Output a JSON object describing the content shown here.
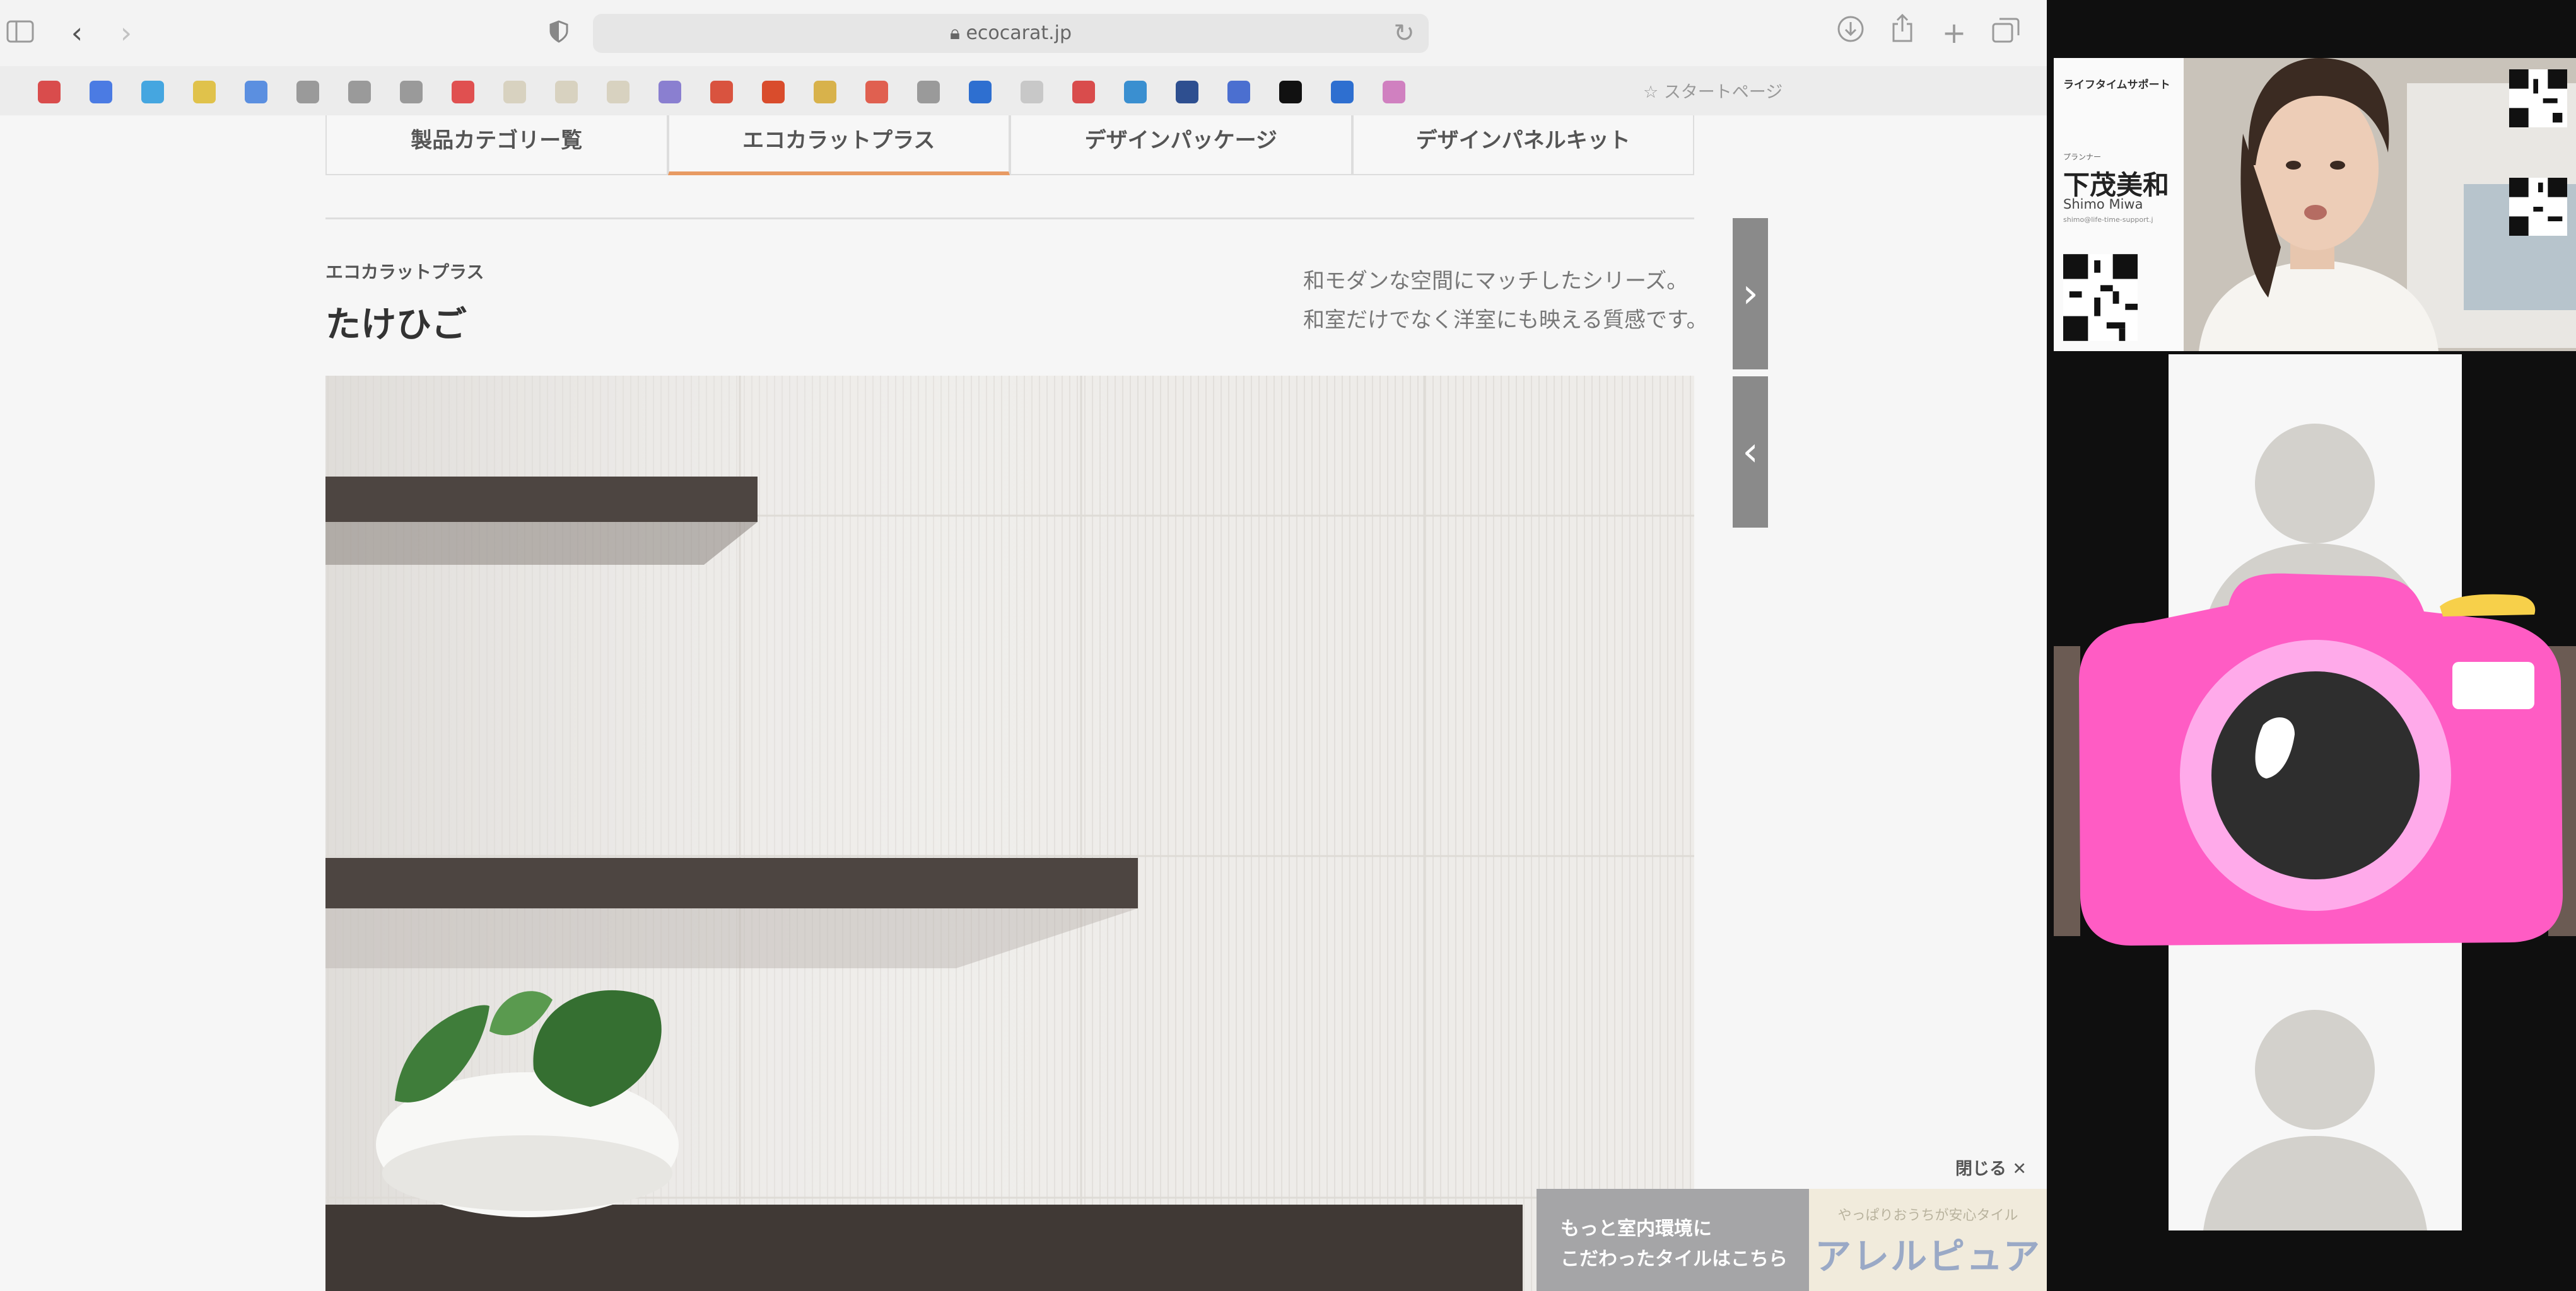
{
  "browser": {
    "url": "ecocarat.jp",
    "start_page_label": "スタートページ",
    "favorites": [
      {
        "color": "#d94c4c"
      },
      {
        "color": "#4b7be3"
      },
      {
        "color": "#45a6e0"
      },
      {
        "color": "#e0c24b"
      },
      {
        "color": "#5b8fe0"
      },
      {
        "color": "#9a9a9a"
      },
      {
        "color": "#9a9a9a"
      },
      {
        "color": "#9a9a9a"
      },
      {
        "color": "#e05050"
      },
      {
        "color": "#d8d2c0"
      },
      {
        "color": "#d8d2c0"
      },
      {
        "color": "#d8d2c0"
      },
      {
        "color": "#8a7fd0"
      },
      {
        "color": "#d9533f"
      },
      {
        "color": "#d94c2c"
      },
      {
        "color": "#d8b24b"
      },
      {
        "color": "#e06050"
      },
      {
        "color": "#9a9a9a"
      },
      {
        "color": "#2e6fd0"
      },
      {
        "color": "#c8c8c8"
      },
      {
        "color": "#d94c4c"
      },
      {
        "color": "#3a8fd0"
      },
      {
        "color": "#2e4f90"
      },
      {
        "color": "#4b6fd0"
      },
      {
        "color": "#111111"
      },
      {
        "color": "#2e6fd0"
      },
      {
        "color": "#d080c0"
      }
    ]
  },
  "page": {
    "tabs": [
      {
        "label": "製品カテゴリー覧",
        "active": false
      },
      {
        "label": "エコカラットプラス",
        "active": true
      },
      {
        "label": "デザインパッケージ",
        "active": false
      },
      {
        "label": "デザインパネルキット",
        "active": false
      }
    ],
    "subtitle": "エコカラットプラス",
    "title": "たけひご",
    "description_line1": "和モダンな空間にマッチしたシリーズ。",
    "description_line2": "和室だけでなく洋室にも映える質感です。",
    "next_glyph": "›",
    "prev_glyph": "‹"
  },
  "banner": {
    "close_label": "閉じる",
    "close_glyph": "✕",
    "line1": "もっと室内環境に",
    "line2": "こだわったタイルはこちら",
    "tagline": "やっぱりおうちが安心タイル",
    "brand": "アレルピュア"
  },
  "video": {
    "card_label": "ライフタイムサポート",
    "card_role": "プランナー",
    "card_name": "下茂美和",
    "card_romaji": "Shimo Miwa",
    "card_email": "shimo@life-time-support.j"
  },
  "colors": {
    "tab_accent": "#e89a63",
    "camera_pink": "#ff5cc4",
    "camera_light_pink": "#ffaaea",
    "camera_yellow": "#f7d04a"
  },
  "icons": [
    "sidebar-icon",
    "back-icon",
    "forward-icon",
    "shield-icon",
    "lock-icon",
    "reload-icon",
    "download-icon",
    "share-icon",
    "plus-icon",
    "tabs-icon",
    "star-icon",
    "camera-icon",
    "person-icon"
  ]
}
